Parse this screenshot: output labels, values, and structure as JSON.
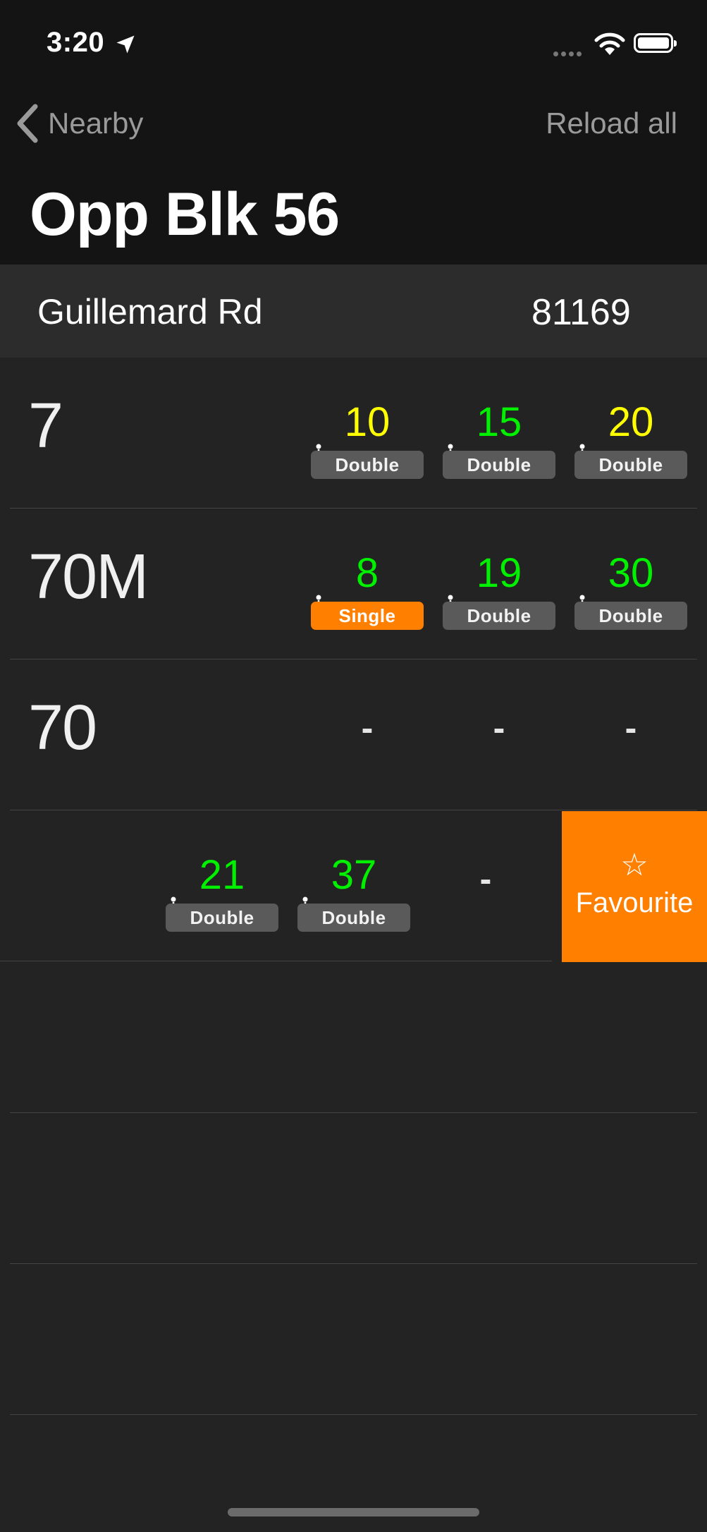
{
  "status_bar": {
    "time": "3:20"
  },
  "nav": {
    "back_label": "Nearby",
    "reload_label": "Reload all",
    "title": "Opp Blk 56"
  },
  "stop": {
    "road": "Guillemard Rd",
    "code": "81169"
  },
  "services": [
    {
      "number": "7",
      "arrivals": [
        {
          "minutes": "10",
          "color": "#ffff00",
          "deck": "Double"
        },
        {
          "minutes": "15",
          "color": "#00f000",
          "deck": "Double"
        },
        {
          "minutes": "20",
          "color": "#ffff00",
          "deck": "Double"
        }
      ]
    },
    {
      "number": "70M",
      "arrivals": [
        {
          "minutes": "8",
          "color": "#00f000",
          "deck": "Single"
        },
        {
          "minutes": "19",
          "color": "#00f000",
          "deck": "Double"
        },
        {
          "minutes": "30",
          "color": "#00f000",
          "deck": "Double"
        }
      ]
    },
    {
      "number": "70",
      "arrivals": [
        {
          "minutes": "-"
        },
        {
          "minutes": "-"
        },
        {
          "minutes": "-"
        }
      ]
    },
    {
      "number": "",
      "arrivals": [
        {
          "minutes": "21",
          "color": "#00f000",
          "deck": "Double"
        },
        {
          "minutes": "37",
          "color": "#00f000",
          "deck": "Double"
        },
        {
          "minutes": "-"
        }
      ]
    }
  ],
  "swipe_action": {
    "icon": "star-outline-icon",
    "star_glyph": "☆",
    "label": "Favourite",
    "color": "#ff7f00"
  }
}
